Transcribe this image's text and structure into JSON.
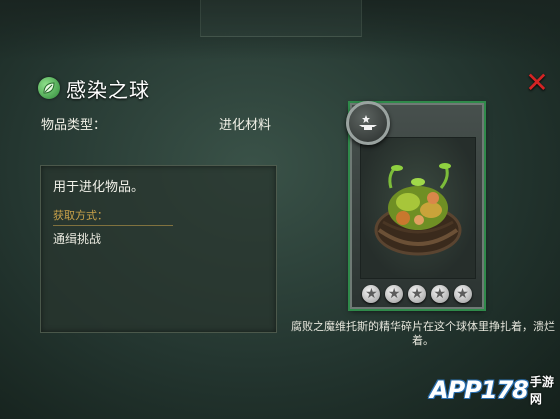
{
  "item": {
    "title": "感染之球",
    "type_label": "物品类型：",
    "type_value": "进化材料",
    "description": "用于进化物品。",
    "obtain_label": "获取方式：",
    "obtain_value": "通缉挑战"
  },
  "card": {
    "stars": 5,
    "lore": "腐败之魔维托斯的精华碎片在这个球体里挣扎着，溃烂着。"
  },
  "watermark": {
    "brand": "APP178",
    "suffix": "手游网"
  },
  "icons": {
    "title": "leaf-icon",
    "close": "close-icon",
    "badge": "anvil-icon",
    "star": "star-icon"
  },
  "colors": {
    "close": "#d42424",
    "accent_green": "#2f8a4a",
    "obtain_label": "#c9a24a"
  }
}
